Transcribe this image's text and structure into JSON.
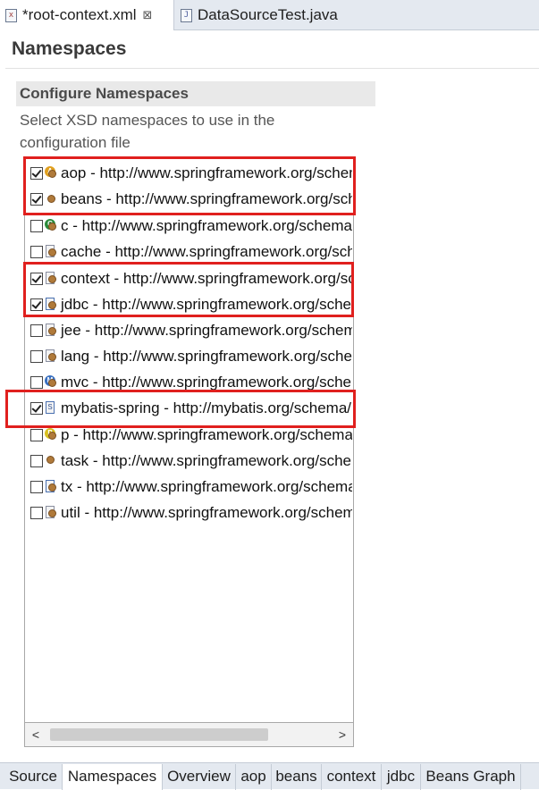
{
  "editor_tabs": [
    {
      "label": "*root-context.xml",
      "close": "⊠",
      "icon": "xml-file-icon",
      "active": true
    },
    {
      "label": "DataSourceTest.java",
      "icon": "java-file-icon",
      "active": false
    }
  ],
  "page": {
    "title": "Namespaces",
    "section_title": "Configure Namespaces",
    "section_desc": "Select XSD namespaces to use in the configuration file"
  },
  "namespaces": [
    {
      "text": "aop - http://www.springframework.org/schema/aop",
      "checked": true,
      "icon": "aop-icon"
    },
    {
      "text": "beans - http://www.springframework.org/schema/beans",
      "checked": true,
      "icon": "bean-icon"
    },
    {
      "text": "c - http://www.springframework.org/schema/c",
      "checked": false,
      "icon": "c-namespace-icon"
    },
    {
      "text": "cache - http://www.springframework.org/schema/cache",
      "checked": false,
      "icon": "cache-icon"
    },
    {
      "text": "context - http://www.springframework.org/schema/context",
      "checked": true,
      "icon": "context-icon"
    },
    {
      "text": "jdbc - http://www.springframework.org/schema/jdbc",
      "checked": true,
      "icon": "jdbc-icon"
    },
    {
      "text": "jee - http://www.springframework.org/schema/jee",
      "checked": false,
      "icon": "jee-icon"
    },
    {
      "text": "lang - http://www.springframework.org/schema/lang",
      "checked": false,
      "icon": "lang-icon"
    },
    {
      "text": "mvc - http://www.springframework.org/schema/mvc",
      "checked": false,
      "icon": "mvc-icon"
    },
    {
      "text": "mybatis-spring - http://mybatis.org/schema/mybatis-spring",
      "checked": true,
      "icon": "mybatis-icon"
    },
    {
      "text": "p - http://www.springframework.org/schema/p",
      "checked": false,
      "icon": "p-namespace-icon"
    },
    {
      "text": "task - http://www.springframework.org/schema/task",
      "checked": false,
      "icon": "task-icon"
    },
    {
      "text": "tx - http://www.springframework.org/schema/tx",
      "checked": false,
      "icon": "tx-icon"
    },
    {
      "text": "util - http://www.springframework.org/schema/util",
      "checked": false,
      "icon": "util-icon"
    }
  ],
  "scrollbar": {
    "left": "<",
    "right": ">"
  },
  "page_tabs": [
    {
      "label": "Source",
      "active": false
    },
    {
      "label": "Namespaces",
      "active": true
    },
    {
      "label": "Overview",
      "active": false
    },
    {
      "label": "aop",
      "active": false
    },
    {
      "label": "beans",
      "active": false
    },
    {
      "label": "context",
      "active": false
    },
    {
      "label": "jdbc",
      "active": false
    },
    {
      "label": "Beans Graph",
      "active": false
    }
  ],
  "colors": {
    "highlight": "#e0201e",
    "tab_bg": "#e4e9f0",
    "header_bg": "#e9e9e9"
  }
}
